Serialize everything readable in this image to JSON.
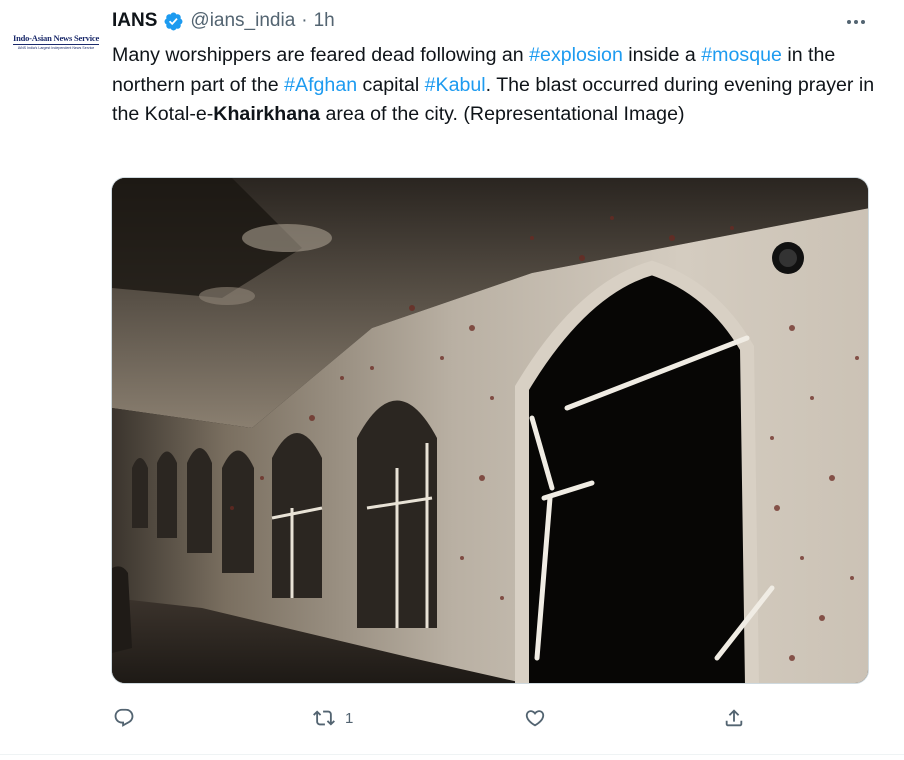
{
  "tweet": {
    "author": {
      "name": "IANS",
      "handle": "@ians_india",
      "separator": "·",
      "time": "1h",
      "avatar_logo_text": "Indo-Asian News Service",
      "avatar_logo_subtext": "IANS India's Largest Independent News Service"
    },
    "body": {
      "t1": "Many worshippers are feared dead following an ",
      "tag1": "#explosion",
      "t2": " inside a ",
      "tag2": "#mosque",
      "t3": " in the northern part of the ",
      "tag3": "#Afghan",
      "t4": " capital ",
      "tag4": "#Kabul",
      "t5": ". The blast occurred during evening prayer in the Kotal-e-",
      "bold1": "Khairkhana",
      "t6": " area of the city. (Representational Image)"
    },
    "actions": {
      "reply_count": "",
      "retweet_count": "1",
      "like_count": "",
      "share_count": ""
    }
  },
  "icons": {
    "verified": "verified-badge-icon",
    "more": "more-horizontal-icon",
    "reply": "reply-icon",
    "retweet": "retweet-icon",
    "like": "heart-icon",
    "share": "share-icon"
  },
  "colors": {
    "accent": "#1d9bf0",
    "text": "#0f1419",
    "secondary": "#536471"
  }
}
